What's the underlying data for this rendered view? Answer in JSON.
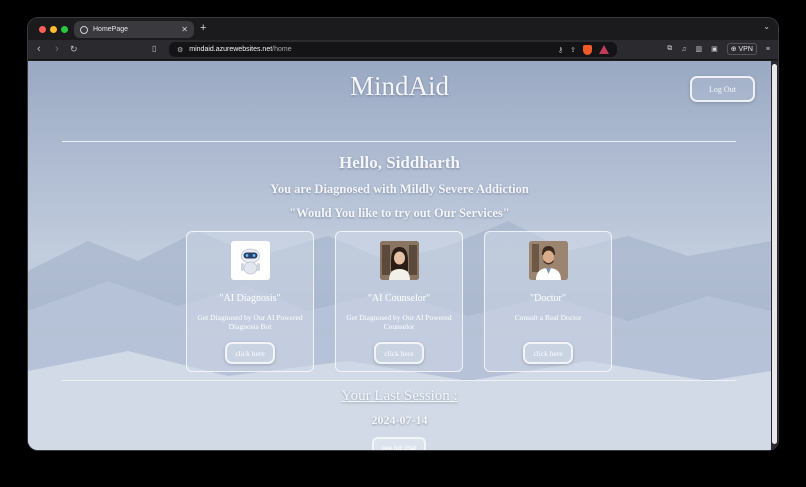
{
  "browser": {
    "tab_title": "HomePage",
    "url_host": "mindaid.azurewebsites.net",
    "url_path": "/home",
    "vpn_label": "VPN",
    "traffic_colors": [
      "#ff5f57",
      "#febc2e",
      "#28c840"
    ]
  },
  "page": {
    "app_title": "MindAid",
    "logout_label": "Log Out",
    "greeting": "Hello, Siddharth",
    "diagnosis": "You are Diagnosed with Mildly Severe Addiction",
    "prompt": "\"Would You like to try out Our Services\"",
    "cards": [
      {
        "title": "\"AI Diagnosis\"",
        "description": "Get Diagnosed by Our AI Powered Diagnosis Bot",
        "button": "click here",
        "icon": "robot-icon"
      },
      {
        "title": "\"AI Counselor\"",
        "description": "Get Diagnosed by Our AI Powered Counselor",
        "button": "click here",
        "icon": "counselor-avatar"
      },
      {
        "title": "\"Doctor\"",
        "description": "Consult a Real Doctor",
        "button": "click here",
        "icon": "doctor-avatar"
      }
    ],
    "last_session_heading": "Your Last Session :",
    "last_session_date": "2024-07-14",
    "chat_button": "see full chat"
  }
}
